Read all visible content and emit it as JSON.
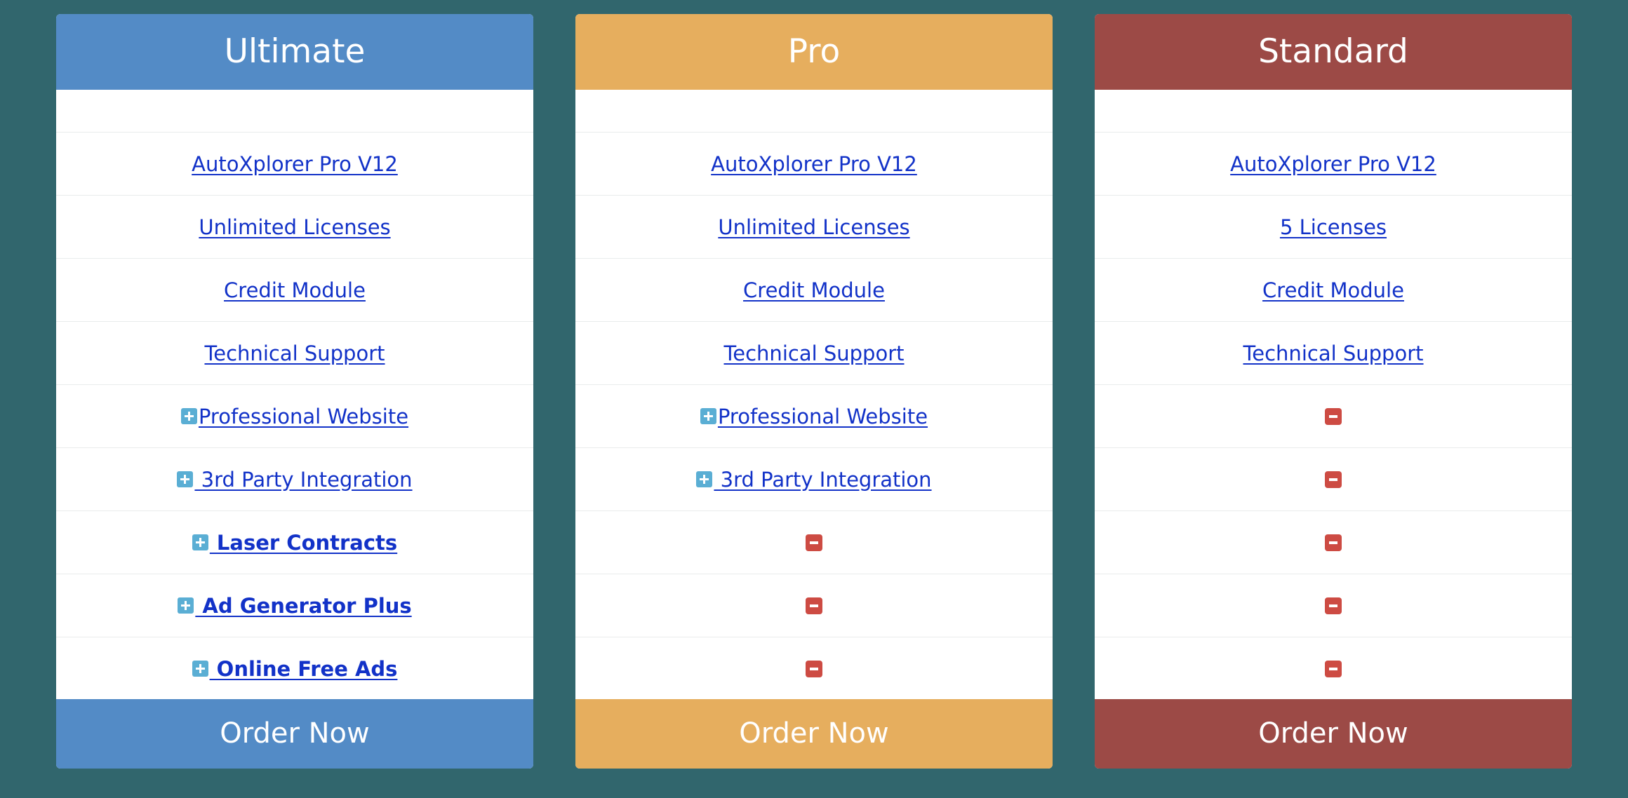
{
  "colors": {
    "page_background": "#31666d",
    "ultimate": "#538bc6",
    "pro": "#e6ae5e",
    "standard": "#9c4a46",
    "link": "#1232c8",
    "included_icon": "#5aaed4",
    "excluded_icon": "#cd4b43"
  },
  "plans": [
    {
      "name": "Ultimate",
      "order_label": "Order Now",
      "features": [
        {
          "label": "AutoXplorer Pro V12",
          "icon": null,
          "bold": false
        },
        {
          "label": "Unlimited Licenses",
          "icon": null,
          "bold": false
        },
        {
          "label": "Credit Module",
          "icon": null,
          "bold": false
        },
        {
          "label": "Technical Support",
          "icon": null,
          "bold": false
        },
        {
          "label": "Professional Website",
          "icon": "plus-square-icon",
          "bold": false
        },
        {
          "label": " 3rd Party Integration",
          "icon": "plus-square-icon",
          "bold": false
        },
        {
          "label": " Laser Contracts",
          "icon": "plus-square-icon",
          "bold": true
        },
        {
          "label": " Ad Generator Plus",
          "icon": "plus-square-icon",
          "bold": true
        },
        {
          "label": " Online Free Ads",
          "icon": "plus-square-icon",
          "bold": true
        }
      ]
    },
    {
      "name": "Pro",
      "order_label": "Order Now",
      "features": [
        {
          "label": "AutoXplorer Pro V12",
          "icon": null,
          "bold": false
        },
        {
          "label": "Unlimited Licenses",
          "icon": null,
          "bold": false
        },
        {
          "label": "Credit Module",
          "icon": null,
          "bold": false
        },
        {
          "label": "Technical Support",
          "icon": null,
          "bold": false
        },
        {
          "label": "Professional Website",
          "icon": "plus-square-icon",
          "bold": false
        },
        {
          "label": " 3rd Party Integration",
          "icon": "plus-square-icon",
          "bold": false
        },
        {
          "label": "",
          "icon": "minus-square-icon",
          "bold": false
        },
        {
          "label": "",
          "icon": "minus-square-icon",
          "bold": false
        },
        {
          "label": "",
          "icon": "minus-square-icon",
          "bold": false
        }
      ]
    },
    {
      "name": "Standard",
      "order_label": "Order Now",
      "features": [
        {
          "label": "AutoXplorer Pro V12",
          "icon": null,
          "bold": false
        },
        {
          "label": "5 Licenses",
          "icon": null,
          "bold": false
        },
        {
          "label": "Credit Module",
          "icon": null,
          "bold": false
        },
        {
          "label": "Technical Support",
          "icon": null,
          "bold": false
        },
        {
          "label": "",
          "icon": "minus-square-icon",
          "bold": false
        },
        {
          "label": "",
          "icon": "minus-square-icon",
          "bold": false
        },
        {
          "label": "",
          "icon": "minus-square-icon",
          "bold": false
        },
        {
          "label": "",
          "icon": "minus-square-icon",
          "bold": false
        },
        {
          "label": "",
          "icon": "minus-square-icon",
          "bold": false
        }
      ]
    }
  ]
}
